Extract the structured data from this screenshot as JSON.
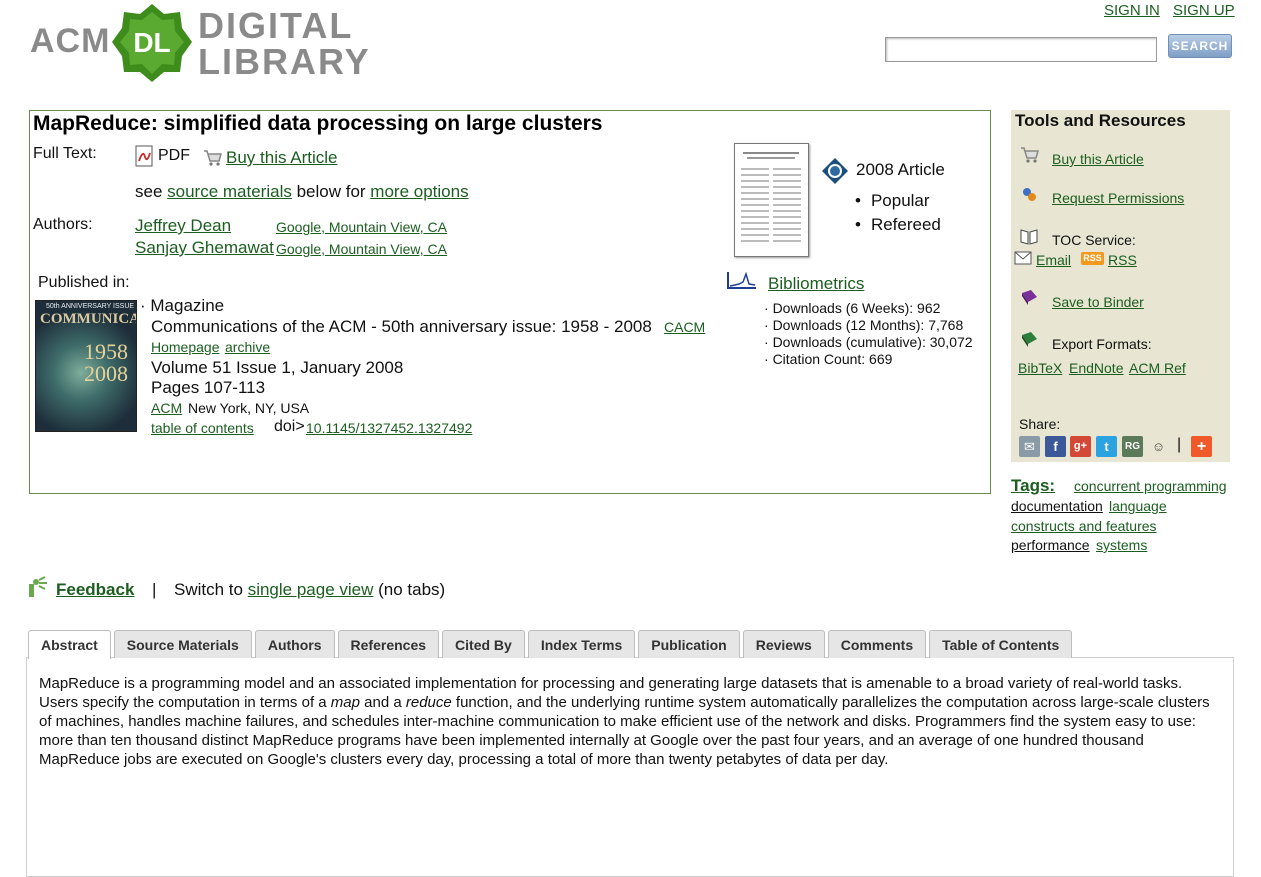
{
  "header": {
    "logo_acm": "ACM",
    "logo_dl": "DL",
    "logo_digital": "DIGITAL",
    "logo_library": "LIBRARY",
    "sign_in": "SIGN IN",
    "sign_up": "SIGN UP",
    "search_value": "",
    "search_button": "SEARCH"
  },
  "article": {
    "title": "MapReduce: simplified data processing on large clusters",
    "full_text_label": "Full Text:",
    "pdf_label": "PDF",
    "buy_label": "Buy this Article",
    "see_prefix": "see ",
    "source_materials": "source materials",
    "below_for": " below for ",
    "more_options": "more options",
    "authors_label": "Authors:",
    "authors": [
      {
        "name": "Jeffrey Dean",
        "affiliation": "Google, Mountain View, CA"
      },
      {
        "name": "Sanjay Ghemawat",
        "affiliation": "Google, Mountain View, CA"
      }
    ],
    "year_label": "2008 Article",
    "badges": [
      "Popular",
      "Refereed"
    ],
    "published_in_label": "Published in:",
    "magazine_type": "Magazine",
    "magazine_title": "Communications of the ACM - 50th anniversary issue: 1958 - 2008",
    "cacm": "CACM",
    "homepage": "Homepage",
    "archive": "archive",
    "volume": "Volume 51 Issue 1, January 2008",
    "pages": "Pages 107-113",
    "publisher": "ACM",
    "publisher_location": "New York, NY, USA",
    "toc": "table of contents",
    "doi_label": "doi>",
    "doi": "10.1145/1327452.1327492",
    "cover": {
      "top": "50th ANNIVERSARY ISSUE",
      "title": "COMMUNICATIONS",
      "years": "1958\n2008"
    }
  },
  "bibliometrics": {
    "label": "Bibliometrics",
    "stats": [
      "Downloads (6 Weeks): 962",
      "Downloads (12 Months): 7,768",
      "Downloads (cumulative): 30,072",
      "Citation Count: 669"
    ]
  },
  "tools": {
    "title": "Tools and Resources",
    "buy": "Buy this Article",
    "permissions": "Request Permissions",
    "toc_service": "TOC Service:",
    "email": "Email",
    "rss_badge": "RSS",
    "rss": "RSS",
    "binder": "Save to Binder",
    "export": "Export Formats:",
    "formats": [
      "BibTeX",
      "EndNote",
      "ACM Ref"
    ],
    "share": "Share:",
    "share_sep": "|"
  },
  "tags": {
    "label": "Tags:",
    "items": [
      "concurrent programming",
      "documentation",
      "language",
      "constructs and features",
      "performance",
      "systems"
    ]
  },
  "feedback": {
    "label": "Feedback",
    "sep": "|",
    "switch_prefix": "Switch to ",
    "switch_link": "single page view",
    "switch_suffix": " (no tabs)"
  },
  "tabs": [
    "Abstract",
    "Source Materials",
    "Authors",
    "References",
    "Cited By",
    "Index Terms",
    "Publication",
    "Reviews",
    "Comments",
    "Table of Contents"
  ],
  "abstract": {
    "p1": "MapReduce is a programming model and an associated implementation for processing and generating large datasets that is amenable to a broad variety of real-world tasks. Users specify the computation in terms of a ",
    "em1": "map",
    "p2": " and a ",
    "em2": "reduce",
    "p3": " function, and the underlying runtime system automatically parallelizes the computation across large-scale clusters of machines, handles machine failures, and schedules inter-machine communication to make efficient use of the network and disks. Programmers find the system easy to use: more than ten thousand distinct MapReduce programs have been implemented internally at Google over the past four years, and an average of one hundred thousand MapReduce jobs are executed on Google's clusters every day, processing a total of more than twenty petabytes of data per day."
  },
  "colors": {
    "link": "#1b5e20",
    "box_border": "#6a8a4a",
    "tools_bg": "#e8e6d2",
    "logo_green": "#3d8c1c"
  }
}
